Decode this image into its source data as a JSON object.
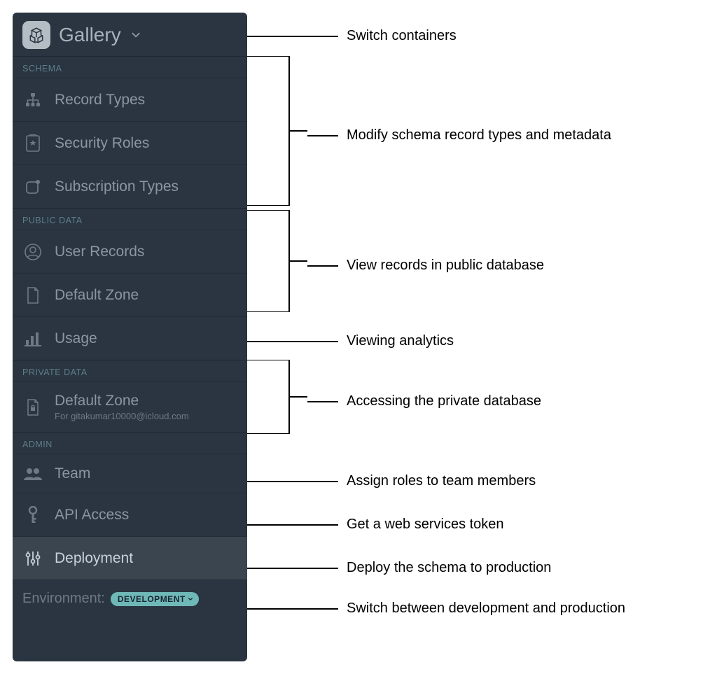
{
  "header": {
    "container_name": "Gallery"
  },
  "sections": {
    "schema": {
      "title": "SCHEMA",
      "items": [
        {
          "label": "Record Types"
        },
        {
          "label": "Security Roles"
        },
        {
          "label": "Subscription Types"
        }
      ]
    },
    "public_data": {
      "title": "PUBLIC DATA",
      "items": [
        {
          "label": "User Records"
        },
        {
          "label": "Default Zone"
        },
        {
          "label": "Usage"
        }
      ]
    },
    "private_data": {
      "title": "PRIVATE DATA",
      "items": [
        {
          "label": "Default Zone",
          "sub": "For gitakumar10000@icloud.com"
        }
      ]
    },
    "admin": {
      "title": "ADMIN",
      "items": [
        {
          "label": "Team"
        },
        {
          "label": "API Access"
        },
        {
          "label": "Deployment"
        }
      ]
    }
  },
  "environment": {
    "label": "Environment:",
    "value": "DEVELOPMENT"
  },
  "callouts": {
    "switch_containers": "Switch containers",
    "modify_schema": "Modify schema record types and metadata",
    "view_public": "View records in public database",
    "view_analytics": "Viewing analytics",
    "private_db": "Accessing the private database",
    "team": "Assign roles to team members",
    "api": "Get a web services token",
    "deploy": "Deploy the schema to production",
    "env": "Switch between development and production"
  }
}
